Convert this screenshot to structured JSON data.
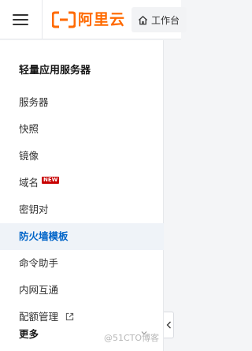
{
  "header": {
    "logo_text": "阿里云",
    "workbench_label": "工作台",
    "brand_color": "#ff6a00"
  },
  "sidebar": {
    "title": "轻量应用服务器",
    "items": [
      {
        "label": "服务器"
      },
      {
        "label": "快照"
      },
      {
        "label": "镜像"
      },
      {
        "label": "域名",
        "badge": "NEW"
      },
      {
        "label": "密钥对"
      },
      {
        "label": "防火墙模板",
        "active": true
      },
      {
        "label": "命令助手"
      },
      {
        "label": "内网互通"
      },
      {
        "label": "配额管理",
        "icon": "external-link-icon"
      }
    ],
    "more_label": "更多",
    "active_color": "#0064c8"
  },
  "watermark": "@51CTO博客"
}
